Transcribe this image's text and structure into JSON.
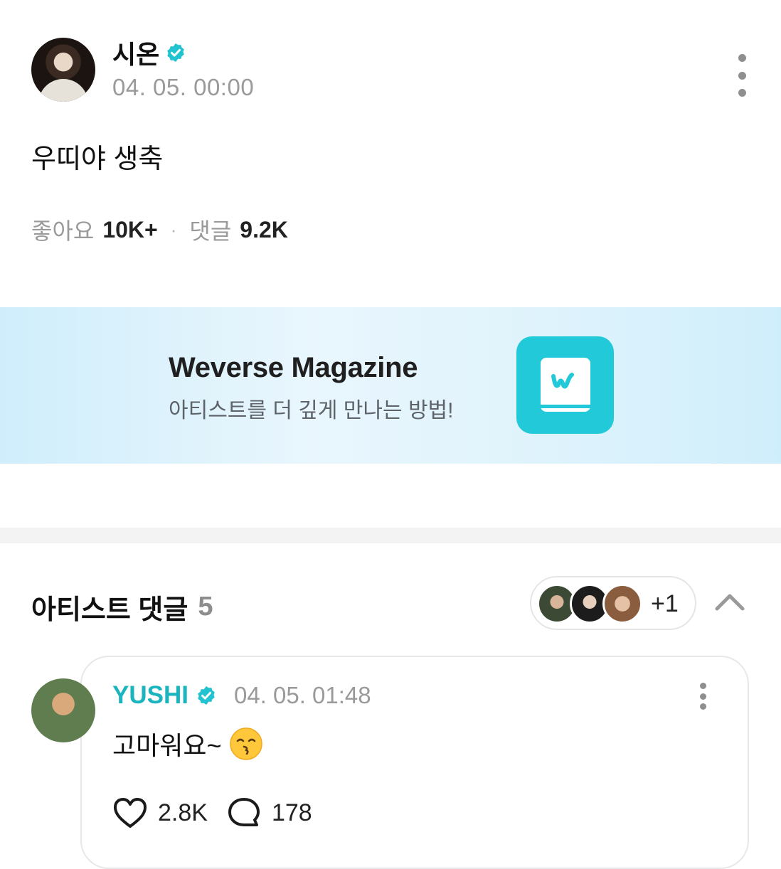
{
  "post": {
    "author": "시온",
    "timestamp": "04. 05. 00:00",
    "body": "우띠야 생축",
    "likes_label": "좋아요",
    "likes_value": "10K+",
    "separator": "·",
    "comments_label": "댓글",
    "comments_value": "9.2K"
  },
  "banner": {
    "title": "Weverse Magazine",
    "subtitle": "아티스트를 더 깊게 만나는 방법!"
  },
  "artist_comments": {
    "title": "아티스트 댓글",
    "count": "5",
    "more_artists": "+1"
  },
  "comment": {
    "author": "YUSHI",
    "timestamp": "04. 05. 01:48",
    "body": "고마워요~",
    "emoji": "kissing-face",
    "likes": "2.8K",
    "replies": "178"
  },
  "colors": {
    "verified": "#22c3d0",
    "accent_name": "#1bb4bf",
    "banner_logo": "#22c9d8"
  }
}
